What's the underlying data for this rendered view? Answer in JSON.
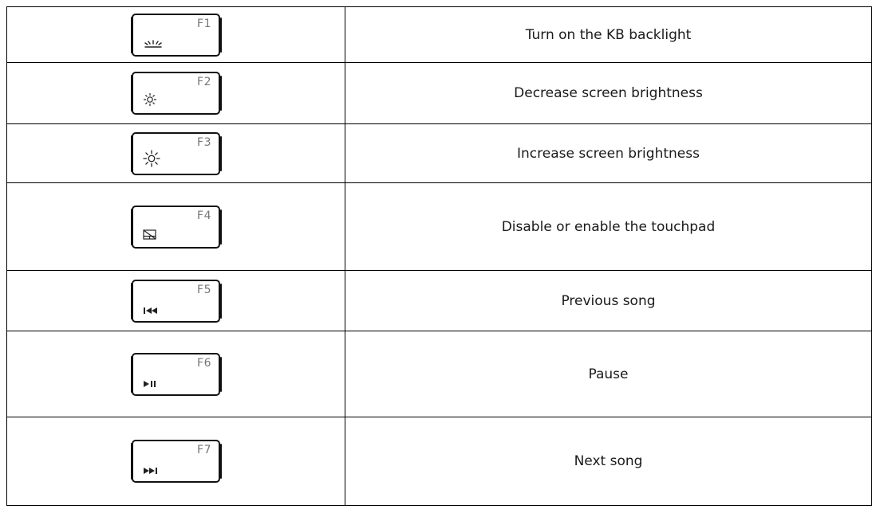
{
  "rows": [
    {
      "key": "F1",
      "icon": "keyboard-backlight-icon",
      "description": "Turn on the KB backlight"
    },
    {
      "key": "F2",
      "icon": "brightness-down-icon",
      "description": "Decrease screen brightness"
    },
    {
      "key": "F3",
      "icon": "brightness-up-icon",
      "description": "Increase screen brightness"
    },
    {
      "key": "F4",
      "icon": "touchpad-toggle-icon",
      "description": "Disable or enable the touchpad"
    },
    {
      "key": "F5",
      "icon": "previous-track-icon",
      "description": "Previous song"
    },
    {
      "key": "F6",
      "icon": "play-pause-icon",
      "description": "Pause"
    },
    {
      "key": "F7",
      "icon": "next-track-icon",
      "description": "Next song"
    }
  ],
  "colors": {
    "border": "#000000",
    "key_label": "#777777",
    "text": "#1a1a1a"
  }
}
